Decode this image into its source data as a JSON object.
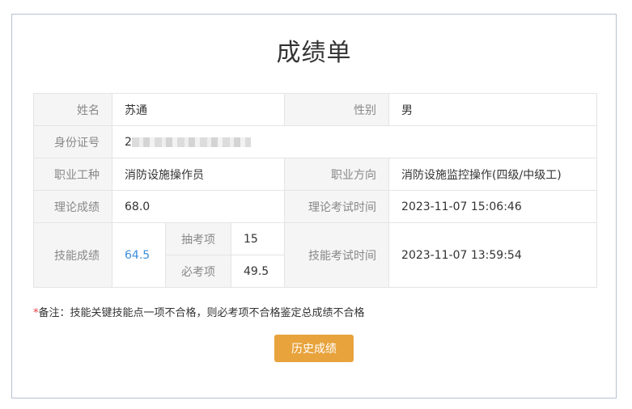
{
  "page": {
    "title": "成绩单"
  },
  "fields": {
    "name_label": "姓名",
    "name": "苏通",
    "gender_label": "性别",
    "gender": "男",
    "id_label": "身份证号",
    "id_visible": "2",
    "occupation_label": "职业工种",
    "occupation": "消防设施操作员",
    "direction_label": "职业方向",
    "direction": "消防设施监控操作(四级/中级工)",
    "theory_score_label": "理论成绩",
    "theory_score": "68.0",
    "theory_time_label": "理论考试时间",
    "theory_time": "2023-11-07 15:06:46",
    "skill_score_label": "技能成绩",
    "skill_score": "64.5",
    "draw_item_label": "抽考项",
    "draw_item_score": "15",
    "required_item_label": "必考项",
    "required_item_score": "49.5",
    "skill_time_label": "技能考试时间",
    "skill_time": "2023-11-07 13:59:54"
  },
  "note": {
    "star": "*",
    "text": "备注：技能关键技能点一项不合格，则必考项不合格鉴定总成绩不合格"
  },
  "actions": {
    "history_label": "历史成绩"
  },
  "colors": {
    "accent": "#e8a33c",
    "link": "#3d8edb",
    "required_star": "#e4393c",
    "border": "#b7c2d3"
  }
}
